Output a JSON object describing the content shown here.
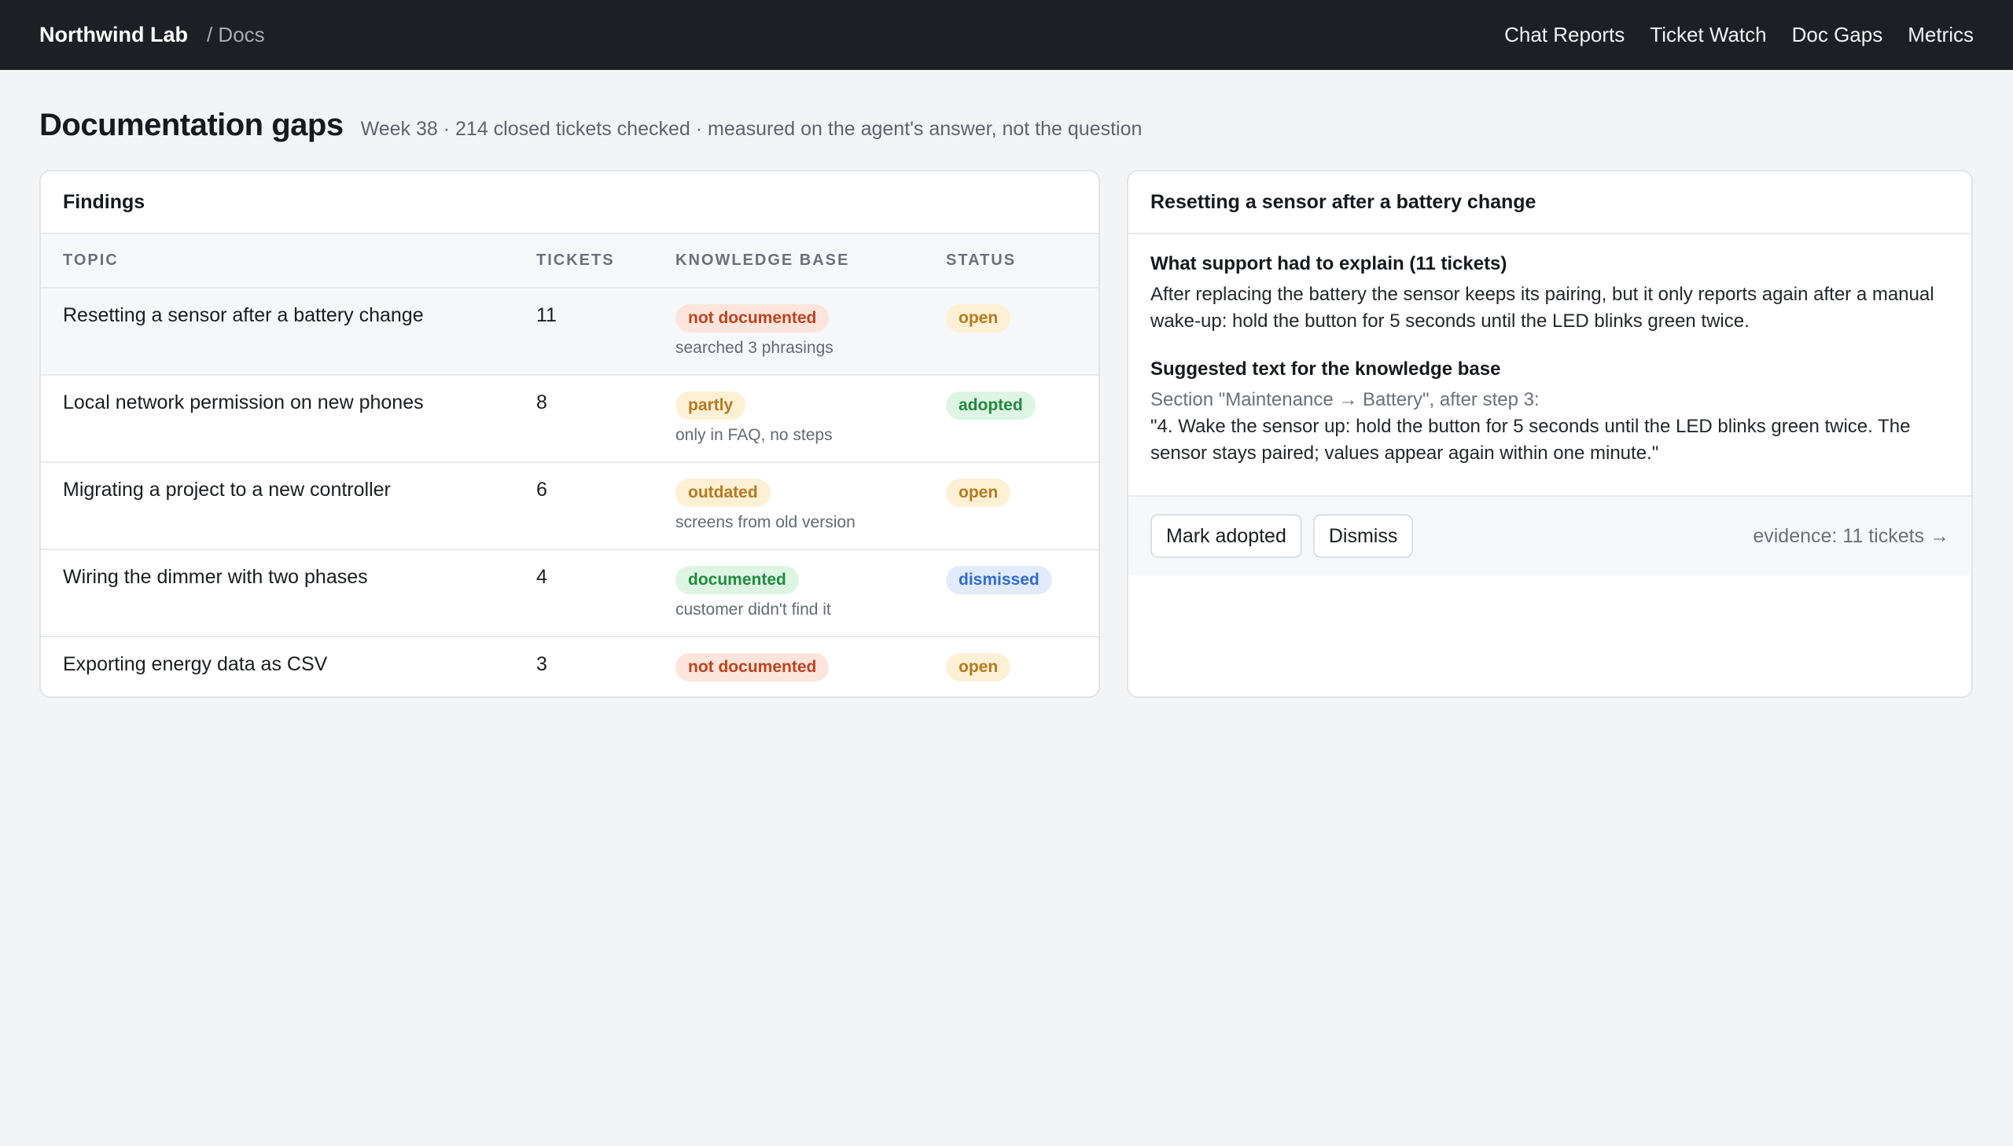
{
  "header": {
    "brand": "Northwind Lab",
    "crumb": "/ Docs",
    "nav": [
      "Chat Reports",
      "Ticket Watch",
      "Doc Gaps",
      "Metrics"
    ]
  },
  "page": {
    "title": "Documentation gaps",
    "subtitle": "Week 38 · 214 closed tickets checked · measured on the agent's answer, not the question"
  },
  "findings": {
    "title": "Findings",
    "columns": [
      "TOPIC",
      "TICKETS",
      "KNOWLEDGE BASE",
      "STATUS"
    ],
    "rows": [
      {
        "topic": "Resetting a sensor after a battery change",
        "tickets": "11",
        "kb": "not documented",
        "kb_note": "searched 3 phrasings",
        "status": "open"
      },
      {
        "topic": "Local network permission on new phones",
        "tickets": "8",
        "kb": "partly",
        "kb_note": "only in FAQ, no steps",
        "status": "adopted"
      },
      {
        "topic": "Migrating a project to a new controller",
        "tickets": "6",
        "kb": "outdated",
        "kb_note": "screens from old version",
        "status": "open"
      },
      {
        "topic": "Wiring the dimmer with two phases",
        "tickets": "4",
        "kb": "documented",
        "kb_note": "customer didn't find it",
        "status": "dismissed"
      },
      {
        "topic": "Exporting energy data as CSV",
        "tickets": "3",
        "kb": "not documented",
        "kb_note": "",
        "status": "open"
      }
    ]
  },
  "detail": {
    "title": "Resetting a sensor after a battery change",
    "explain_heading": "What support had to explain (11 tickets)",
    "explain_text": "After replacing the battery the sensor keeps its pairing, but it only reports again after a manual wake-up: hold the button for 5 seconds until the LED blinks green twice.",
    "suggest_heading": "Suggested text for the knowledge base",
    "suggest_meta": "Section \"Maintenance → Battery\", after step 3:",
    "suggest_text": "\"4. Wake the sensor up: hold the button for 5 seconds until the LED blinks green twice. The sensor stays paired; values appear again within one minute.\"",
    "adopt_label": "Mark adopted",
    "dismiss_label": "Dismiss",
    "evidence_label": "evidence: 11 tickets →"
  }
}
